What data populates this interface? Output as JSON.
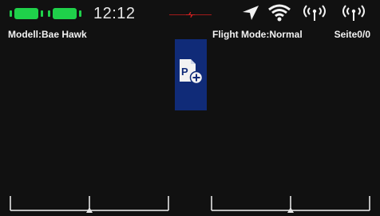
{
  "status_bar": {
    "time": "12:12",
    "battery_color": "#1fd14a",
    "link_color": "#d11f1f",
    "icons": [
      "battery-icon",
      "battery-icon",
      "telemetry-link-icon",
      "gps-arrow-icon",
      "wifi-icon",
      "rf-signal-icon",
      "rf-signal-icon"
    ]
  },
  "header": {
    "model": "Modell:Bae Hawk",
    "flight_mode": "Flight Mode:Normal",
    "page": "Seite0/0"
  },
  "main": {
    "add_page_icon": "add-page-icon",
    "tile_color": "#102b78"
  },
  "trims": {
    "left_value": 0,
    "right_value": 0
  }
}
